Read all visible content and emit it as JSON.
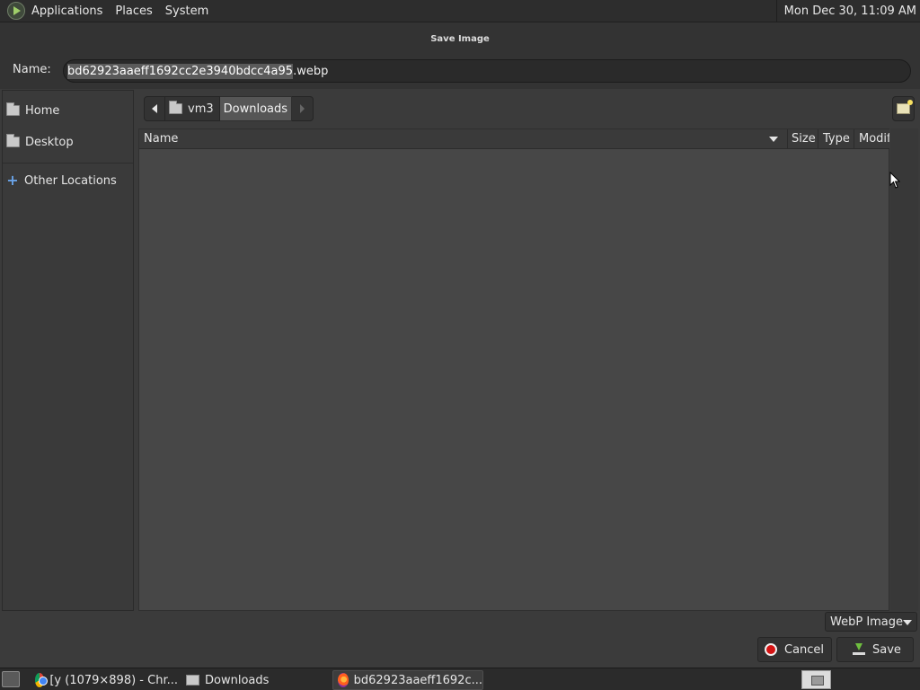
{
  "top_panel": {
    "menus": [
      "Applications",
      "Places",
      "System"
    ],
    "clock": "Mon Dec 30, 11:09 AM",
    "logo_icon": "mate-logo-icon"
  },
  "dialog": {
    "title": "Save Image",
    "name_label": "Name:",
    "filename_selected": "bd62923aaeff1692cc2e3940bdcc4a95",
    "filename_ext": ".webp"
  },
  "sidebar": {
    "items": [
      {
        "label": "Home",
        "icon": "home-folder-icon"
      },
      {
        "label": "Desktop",
        "icon": "desktop-folder-icon"
      },
      {
        "label": "Other Locations",
        "icon": "plus-icon"
      }
    ]
  },
  "pathbar": {
    "segments": [
      "vm3",
      "Downloads"
    ],
    "current": "Downloads"
  },
  "file_list": {
    "columns": [
      "Name",
      "Size",
      "Type",
      "Modif"
    ],
    "rows": []
  },
  "filter": {
    "selected": "WebP Image"
  },
  "buttons": {
    "cancel": "Cancel",
    "save": "Save"
  },
  "taskbar": {
    "tasks": [
      {
        "label": "[y (1079×898) - Chr...",
        "icon": "chrome-icon"
      },
      {
        "label": "Downloads",
        "icon": "folder-icon"
      },
      {
        "label": "bd62923aaeff1692c...",
        "icon": "firefox-icon",
        "active": true
      }
    ]
  },
  "colors": {
    "panel": "#2d2d2d",
    "dialog_bg": "#333333",
    "list_bg": "#474747",
    "accent_red": "#d41414",
    "accent_green": "#6fbf3f"
  }
}
